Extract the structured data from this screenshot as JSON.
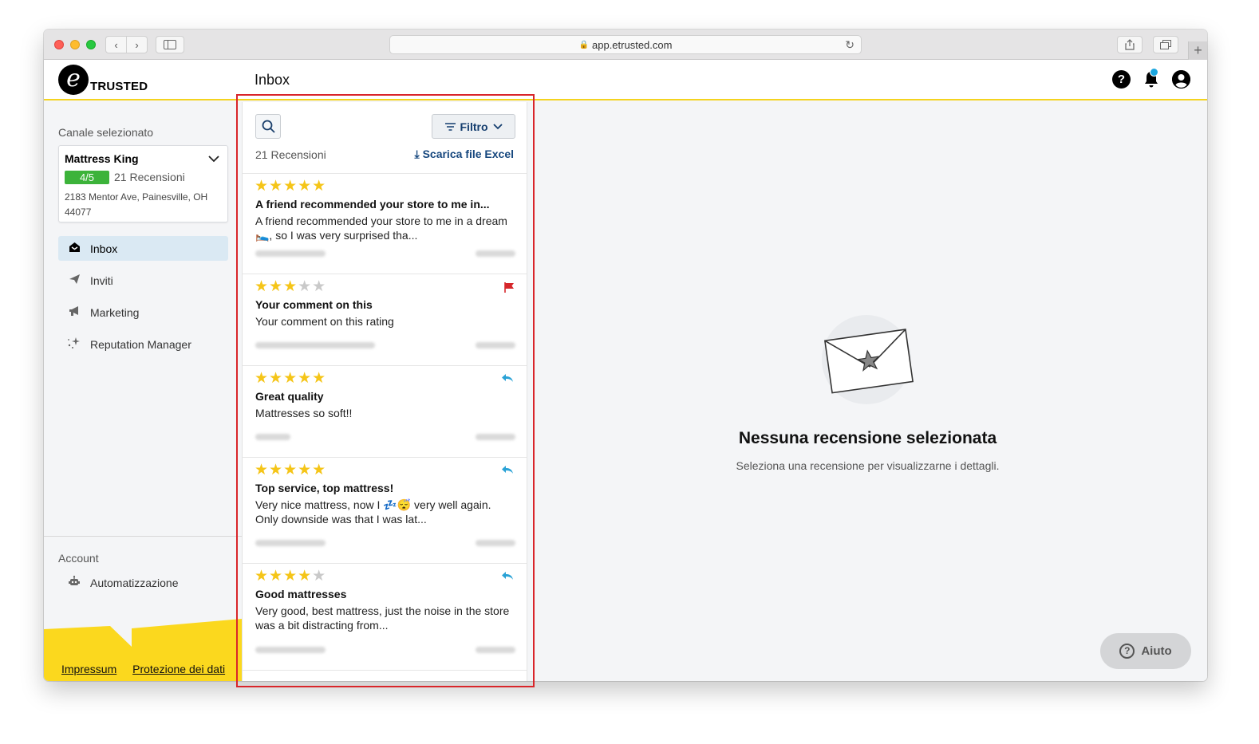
{
  "browser": {
    "url": "app.etrusted.com"
  },
  "header": {
    "logo_letter": "e",
    "logo_text": "TRUSTED",
    "page_title": "Inbox",
    "help_glyph": "?"
  },
  "sidebar": {
    "channel_label": "Canale selezionato",
    "channel": {
      "name": "Mattress King",
      "rating": "4/5",
      "review_count": "21 Recensioni",
      "address": "2183 Mentor Ave, Painesville, OH 44077"
    },
    "nav": [
      {
        "label": "Inbox",
        "icon": "inbox-icon",
        "active": true
      },
      {
        "label": "Inviti",
        "icon": "paper-plane-icon",
        "active": false
      },
      {
        "label": "Marketing",
        "icon": "megaphone-icon",
        "active": false
      },
      {
        "label": "Reputation Manager",
        "icon": "sparkle-stars-icon",
        "active": false
      }
    ],
    "account_label": "Account",
    "account_nav": [
      {
        "label": "Automatizzazione",
        "icon": "robot-icon"
      }
    ],
    "footer_links": [
      "Impressum",
      "Protezione dei dati"
    ],
    "accent_color": "#fbd81e"
  },
  "list": {
    "filter_label": "Filtro",
    "count": "21 Recensioni",
    "export_label": "Scarica file Excel",
    "reviews": [
      {
        "stars": 5,
        "title": "A friend recommended your store to me in...",
        "body": "A friend recommended your store to me in a dream 🛌, so I was very surprised tha...",
        "marker": "none"
      },
      {
        "stars": 3,
        "title": "Your comment on this",
        "body": "Your comment on this rating",
        "marker": "flag"
      },
      {
        "stars": 5,
        "title": "Great quality",
        "body": "Mattresses so soft!!",
        "marker": "reply"
      },
      {
        "stars": 5,
        "title": "Top service, top mattress!",
        "body": "Very nice mattress, now I 💤😴 very well again. Only downside was that I was lat...",
        "marker": "reply"
      },
      {
        "stars": 4,
        "title": "Good mattresses",
        "body": "Very good, best mattress, just the noise in the store was a bit distracting from...",
        "marker": "reply"
      }
    ]
  },
  "detail": {
    "empty_title": "Nessuna recensione selezionata",
    "empty_subtitle": "Seleziona una recensione per visualizzarne i dettagli.",
    "help_button": "Aiuto"
  },
  "colors": {
    "highlight_box": "#d9252a",
    "star": "#f5c518",
    "rating_badge": "#3cb33a",
    "link_blue": "#16477e"
  }
}
